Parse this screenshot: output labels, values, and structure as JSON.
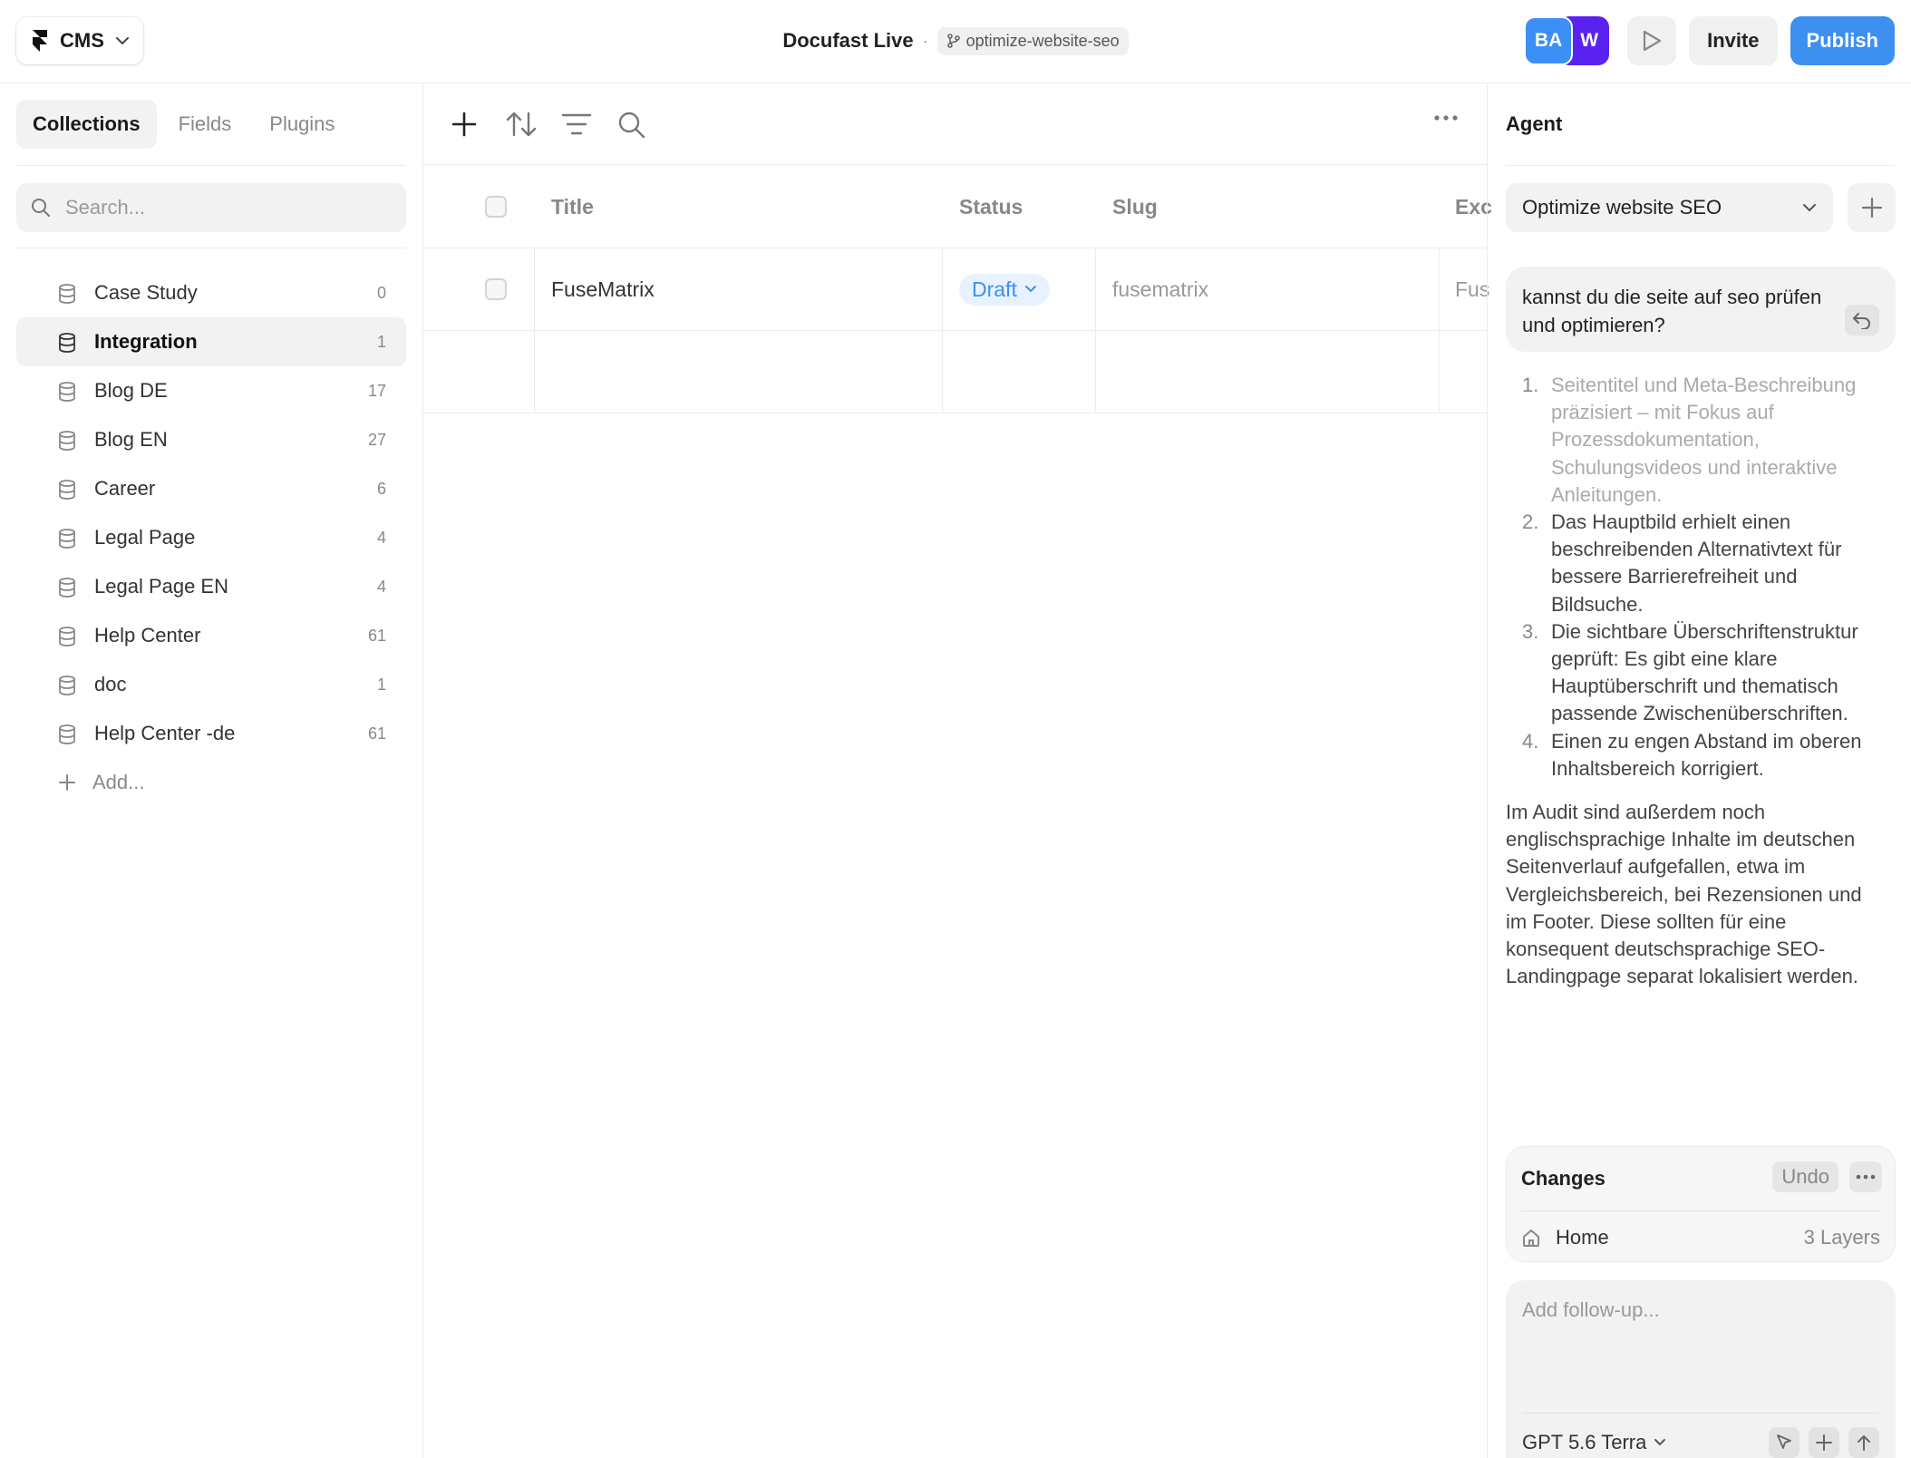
{
  "topbar": {
    "app_label": "CMS",
    "project_name": "Docufast Live",
    "separator": "·",
    "branch": "optimize-website-seo",
    "avatars": [
      {
        "initials": "BA",
        "color": "#3b8ff5"
      },
      {
        "initials": "W",
        "color": "#5a22f0"
      }
    ],
    "invite_label": "Invite",
    "publish_label": "Publish",
    "accent_color": "#3d8ff0"
  },
  "sidebar": {
    "tabs": [
      {
        "label": "Collections",
        "active": true
      },
      {
        "label": "Fields",
        "active": false
      },
      {
        "label": "Plugins",
        "active": false
      }
    ],
    "search_placeholder": "Search...",
    "collections": [
      {
        "name": "Case Study",
        "count": "0",
        "active": false
      },
      {
        "name": "Integration",
        "count": "1",
        "active": true
      },
      {
        "name": "Blog DE",
        "count": "17",
        "active": false
      },
      {
        "name": "Blog EN",
        "count": "27",
        "active": false
      },
      {
        "name": "Career",
        "count": "6",
        "active": false
      },
      {
        "name": "Legal Page",
        "count": "4",
        "active": false
      },
      {
        "name": "Legal Page EN",
        "count": "4",
        "active": false
      },
      {
        "name": "Help Center",
        "count": "61",
        "active": false
      },
      {
        "name": "doc",
        "count": "1",
        "active": false
      },
      {
        "name": "Help Center -de",
        "count": "61",
        "active": false
      }
    ],
    "add_label": "Add..."
  },
  "main": {
    "toolbar_icons": [
      "plus-icon",
      "sort-icon",
      "filter-icon",
      "search-icon",
      "more-icon"
    ],
    "table": {
      "headers": {
        "title": "Title",
        "status": "Status",
        "slug": "Slug",
        "excerpt": "Exc"
      },
      "rows": [
        {
          "title": "FuseMatrix",
          "status": "Draft",
          "slug": "fusematrix",
          "excerpt": "Fus"
        }
      ]
    }
  },
  "agent": {
    "title": "Agent",
    "selected_task": "Optimize website SEO",
    "user_message": "kannst du die seite auf seo prüfen und optimieren?",
    "reply_items": [
      {
        "num": "1.",
        "text": "Seitentitel und Meta-Beschreibung präzisiert – mit Fokus auf Prozessdokumentation, Schulungsvideos und interaktive Anleitungen."
      },
      {
        "num": "2.",
        "text": "Das Hauptbild erhielt einen beschreibenden Alternativtext für bessere Barrierefreiheit und Bildsuche."
      },
      {
        "num": "3.",
        "text": "Die sichtbare Überschriftenstruktur geprüft: Es gibt eine klare Hauptüberschrift und thematisch passende Zwischenüberschriften."
      },
      {
        "num": "4.",
        "text": "Einen zu engen Abstand im oberen Inhaltsbereich korrigiert."
      }
    ],
    "reply_paragraph": "Im Audit sind außerdem noch englischsprachige Inhalte im deutschen Seitenverlauf aufgefallen, etwa im Vergleichsbereich, bei Rezensionen und im Footer. Diese sollten für eine konsequent deutschsprachige SEO-Landingpage separat lokalisiert werden.",
    "changes": {
      "title": "Changes",
      "undo_label": "Undo",
      "page": "Home",
      "layers": "3 Layers"
    },
    "followup_placeholder": "Add follow-up...",
    "model": "GPT 5.6 Terra",
    "footer_branch": "optimize-website-seo"
  }
}
